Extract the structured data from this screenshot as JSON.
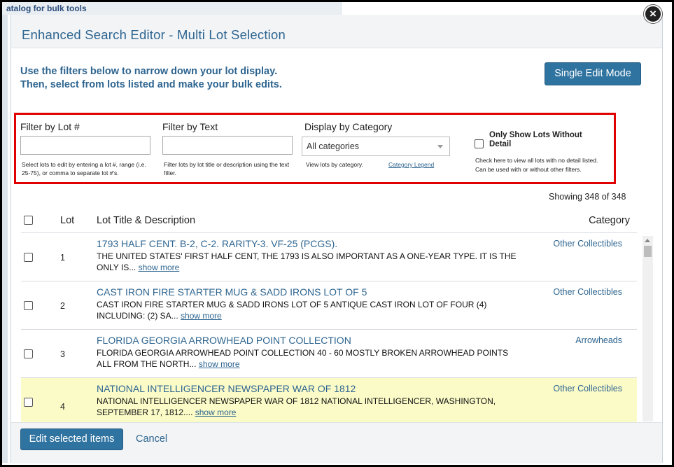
{
  "background": {
    "text": "atalog for bulk tools"
  },
  "dialog": {
    "title": "Enhanced Search Editor - Multi Lot Selection",
    "close_glyph": "×",
    "instructions": "Use the filters below to narrow down your lot display. Then, select from lots listed and make your bulk edits.",
    "single_edit_label": "Single Edit Mode"
  },
  "filters": {
    "lot_label": "Filter by Lot #",
    "lot_value": "",
    "lot_help": "Select lots to edit by entering a lot #, range (i.e. 25-75), or comma to separate lot #'s.",
    "text_label": "Filter by Text",
    "text_value": "",
    "text_help": "Filter lots by lot title or description using the text filter.",
    "category_label": "Display by Category",
    "category_selected": "All categories",
    "category_help": "View lots by category.",
    "category_legend": "Category Legend",
    "without_detail_label": "Only Show Lots Without Detail",
    "without_detail_checked": false,
    "without_detail_help": "Check here to view all lots with no detail listed. Can be used with or without other filters."
  },
  "list": {
    "showing": "Showing 348 of 348",
    "headers": {
      "lot": "Lot",
      "title": "Lot Title & Description",
      "category": "Category"
    },
    "show_more_label": "show more",
    "rows": [
      {
        "lot": "1",
        "title": "1793 HALF CENT. B-2, C-2. RARITY-3. VF-25 (PCGS).",
        "desc": "THE UNITED STATES' FIRST HALF CENT, THE 1793 IS ALSO IMPORTANT AS A ONE-YEAR TYPE. IT IS THE ONLY IS...",
        "category": "Other Collectibles",
        "highlighted": false
      },
      {
        "lot": "2",
        "title": "CAST IRON FIRE STARTER MUG & SADD IRONS LOT OF 5",
        "desc": "CAST IRON FIRE STARTER MUG & SADD IRONS LOT OF 5 ANTIQUE CAST IRON LOT OF FOUR (4) INCLUDING: (2) SA...",
        "category": "Other Collectibles",
        "highlighted": false
      },
      {
        "lot": "3",
        "title": "FLORIDA GEORGIA ARROWHEAD POINT COLLECTION",
        "desc": "FLORIDA GEORGIA ARROWHEAD POINT COLLECTION 40 - 60 MOSTLY BROKEN ARROWHEAD POINTS ALL FROM THE NORTH...",
        "category": "Arrowheads",
        "highlighted": false
      },
      {
        "lot": "4",
        "title": "NATIONAL INTELLIGENCER NEWSPAPER WAR OF 1812",
        "desc": "NATIONAL INTELLIGENCER NEWSPAPER WAR OF 1812 NATIONAL INTELLIGENCER, WASHINGTON, SEPTEMBER 17, 1812....",
        "category": "Other Collectibles",
        "highlighted": true
      }
    ]
  },
  "footer": {
    "edit_label": "Edit selected items",
    "cancel_label": "Cancel"
  },
  "colors": {
    "accent": "#2e6590",
    "button": "#2f73a0",
    "highlight_row": "#fbfbc8",
    "filter_border": "#e00000"
  }
}
